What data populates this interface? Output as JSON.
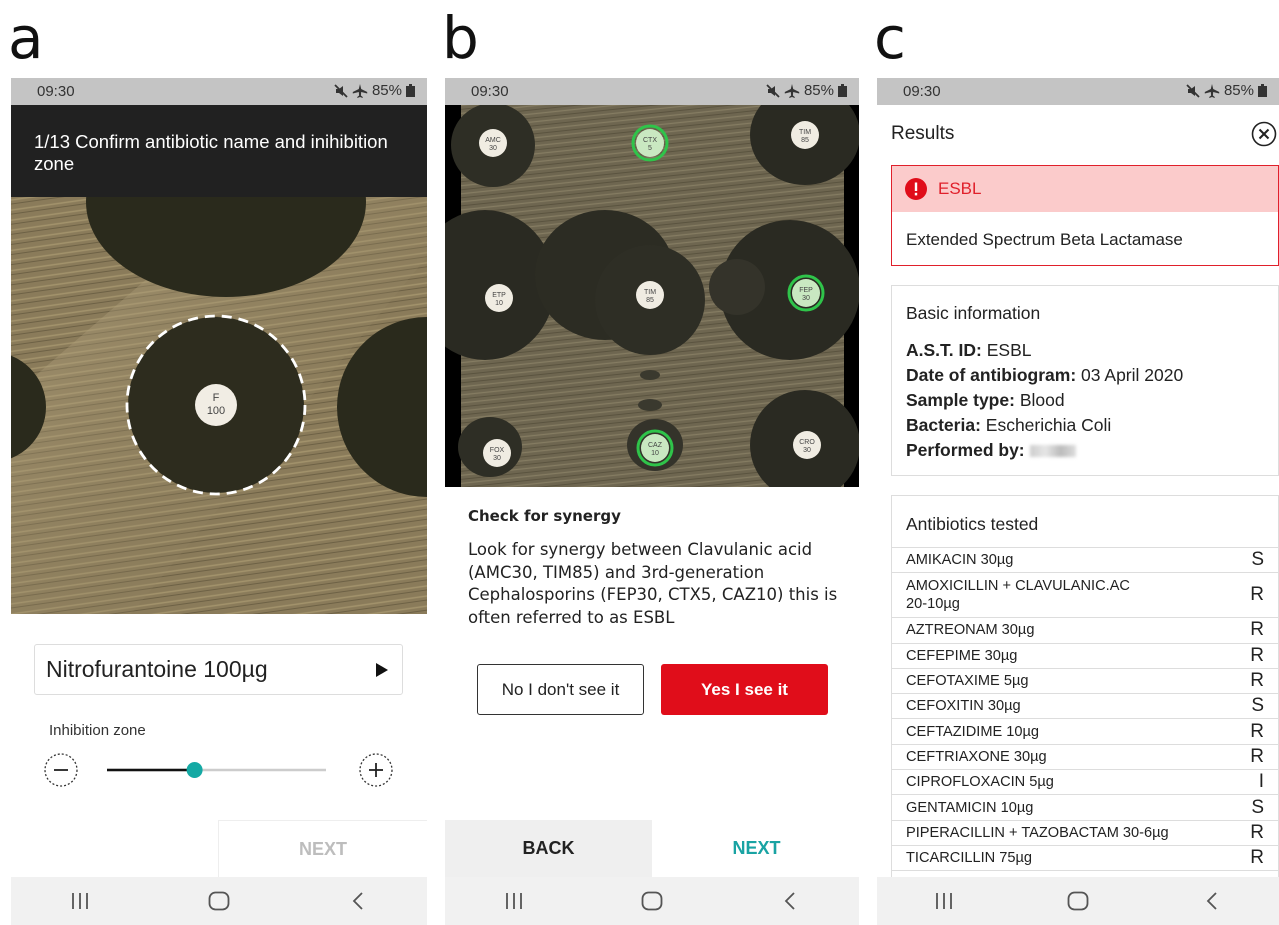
{
  "panel_letters": [
    "a",
    "b",
    "c"
  ],
  "status": {
    "time": "09:30",
    "battery": "85%"
  },
  "panel_a": {
    "header": "1/13 Confirm antibiotic name and inihibition zone",
    "disk_label_line1": "F",
    "disk_label_line2": "100",
    "antibiotic": "Nitrofurantoine 100µg",
    "inhibition_label": "Inhibition zone",
    "slider_fraction": 0.4,
    "next_label": "NEXT"
  },
  "panel_b": {
    "disks": [
      {
        "l1": "AMC",
        "l2": "30",
        "green": false
      },
      {
        "l1": "CTX",
        "l2": "5",
        "green": true
      },
      {
        "l1": "TIM",
        "l2": "85",
        "green": false
      },
      {
        "l1": "ETP",
        "l2": "10",
        "green": false
      },
      {
        "l1": "TIM",
        "l2": "85",
        "green": false
      },
      {
        "l1": "FEP",
        "l2": "30",
        "green": true
      },
      {
        "l1": "FOX",
        "l2": "30",
        "green": false
      },
      {
        "l1": "CAZ",
        "l2": "10",
        "green": true
      },
      {
        "l1": "CRO",
        "l2": "30",
        "green": false
      }
    ],
    "title": "Check for synergy",
    "body": "Look for synergy between Clavulanic acid (AMC30, TIM85) and 3rd-generation Cephalosporins (FEP30, CTX5, CAZ10) this is often referred to as ESBL",
    "no_label": "No I don't see it",
    "yes_label": "Yes I see it",
    "back_label": "BACK",
    "next_label": "NEXT"
  },
  "panel_c": {
    "title": "Results",
    "alert_title": "ESBL",
    "alert_body": "Extended Spectrum Beta Lactamase",
    "basic_title": "Basic information",
    "basic": [
      {
        "label": "A.S.T. ID:",
        "value": "ESBL"
      },
      {
        "label": "Date of antibiogram:",
        "value": "03 April 2020"
      },
      {
        "label": "Sample type:",
        "value": "Blood"
      },
      {
        "label": "Bacteria:",
        "value": "Escherichia Coli"
      },
      {
        "label": "Performed by:",
        "value": ""
      }
    ],
    "abx_title": "Antibiotics tested",
    "antibiotics": [
      {
        "name": "AMIKACIN 30µg",
        "result": "S"
      },
      {
        "name": "AMOXICILLIN + CLAVULANIC.AC",
        "name2": "20-10µg",
        "result": "R"
      },
      {
        "name": "AZTREONAM 30µg",
        "result": "R"
      },
      {
        "name": "CEFEPIME 30µg",
        "result": "R"
      },
      {
        "name": "CEFOTAXIME 5µg",
        "result": "R"
      },
      {
        "name": "CEFOXITIN 30µg",
        "result": "S"
      },
      {
        "name": "CEFTAZIDIME 10µg",
        "result": "R"
      },
      {
        "name": "CEFTRIAXONE 30µg",
        "result": "R"
      },
      {
        "name": "CIPROFLOXACIN 5µg",
        "result": "I"
      },
      {
        "name": "GENTAMICIN 10µg",
        "result": "S"
      },
      {
        "name": "PIPERACILLIN + TAZOBACTAM 30-6µg",
        "result": "R"
      },
      {
        "name": "TICARCILLIN 75µg",
        "result": "R"
      }
    ]
  },
  "colors": {
    "accent_teal": "#19a3a3",
    "danger_red": "#e00d1a",
    "alert_bg": "#fbcbcb"
  },
  "icons": [
    "mute-icon",
    "airplane-icon",
    "battery-icon",
    "play-icon",
    "minus-icon",
    "plus-icon",
    "close-icon",
    "alert-icon",
    "recents-icon",
    "home-icon",
    "back-icon"
  ]
}
